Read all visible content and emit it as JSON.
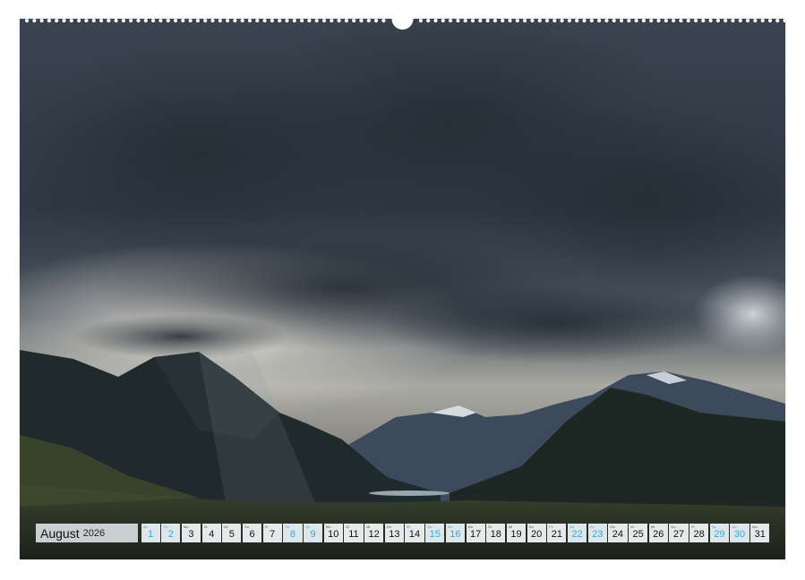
{
  "calendar": {
    "month": "August",
    "year": "2026",
    "days": [
      {
        "num": "1",
        "abbr": "Sa",
        "weekend": true
      },
      {
        "num": "2",
        "abbr": "So",
        "weekend": true
      },
      {
        "num": "3",
        "abbr": "Mo",
        "weekend": false
      },
      {
        "num": "4",
        "abbr": "Di",
        "weekend": false
      },
      {
        "num": "5",
        "abbr": "Mi",
        "weekend": false
      },
      {
        "num": "6",
        "abbr": "Do",
        "weekend": false
      },
      {
        "num": "7",
        "abbr": "Fr",
        "weekend": false
      },
      {
        "num": "8",
        "abbr": "Sa",
        "weekend": true
      },
      {
        "num": "9",
        "abbr": "So",
        "weekend": true
      },
      {
        "num": "10",
        "abbr": "Mo",
        "weekend": false
      },
      {
        "num": "11",
        "abbr": "Di",
        "weekend": false
      },
      {
        "num": "12",
        "abbr": "Mi",
        "weekend": false
      },
      {
        "num": "13",
        "abbr": "Do",
        "weekend": false
      },
      {
        "num": "14",
        "abbr": "Fr",
        "weekend": false
      },
      {
        "num": "15",
        "abbr": "Sa",
        "weekend": true
      },
      {
        "num": "16",
        "abbr": "So",
        "weekend": true
      },
      {
        "num": "17",
        "abbr": "Mo",
        "weekend": false
      },
      {
        "num": "18",
        "abbr": "Di",
        "weekend": false
      },
      {
        "num": "19",
        "abbr": "Mi",
        "weekend": false
      },
      {
        "num": "20",
        "abbr": "Do",
        "weekend": false
      },
      {
        "num": "21",
        "abbr": "Fr",
        "weekend": false
      },
      {
        "num": "22",
        "abbr": "Sa",
        "weekend": true
      },
      {
        "num": "23",
        "abbr": "So",
        "weekend": true
      },
      {
        "num": "24",
        "abbr": "Mo",
        "weekend": false
      },
      {
        "num": "25",
        "abbr": "Di",
        "weekend": false
      },
      {
        "num": "26",
        "abbr": "Mi",
        "weekend": false
      },
      {
        "num": "27",
        "abbr": "Do",
        "weekend": false
      },
      {
        "num": "28",
        "abbr": "Fr",
        "weekend": false
      },
      {
        "num": "29",
        "abbr": "Sa",
        "weekend": true
      },
      {
        "num": "30",
        "abbr": "So",
        "weekend": true
      },
      {
        "num": "31",
        "abbr": "Mo",
        "weekend": false
      }
    ]
  },
  "colors": {
    "weekend_accent": "#3aa8d8",
    "sky_dark": "#2e3a48",
    "mountain": "#1f2a2c"
  }
}
